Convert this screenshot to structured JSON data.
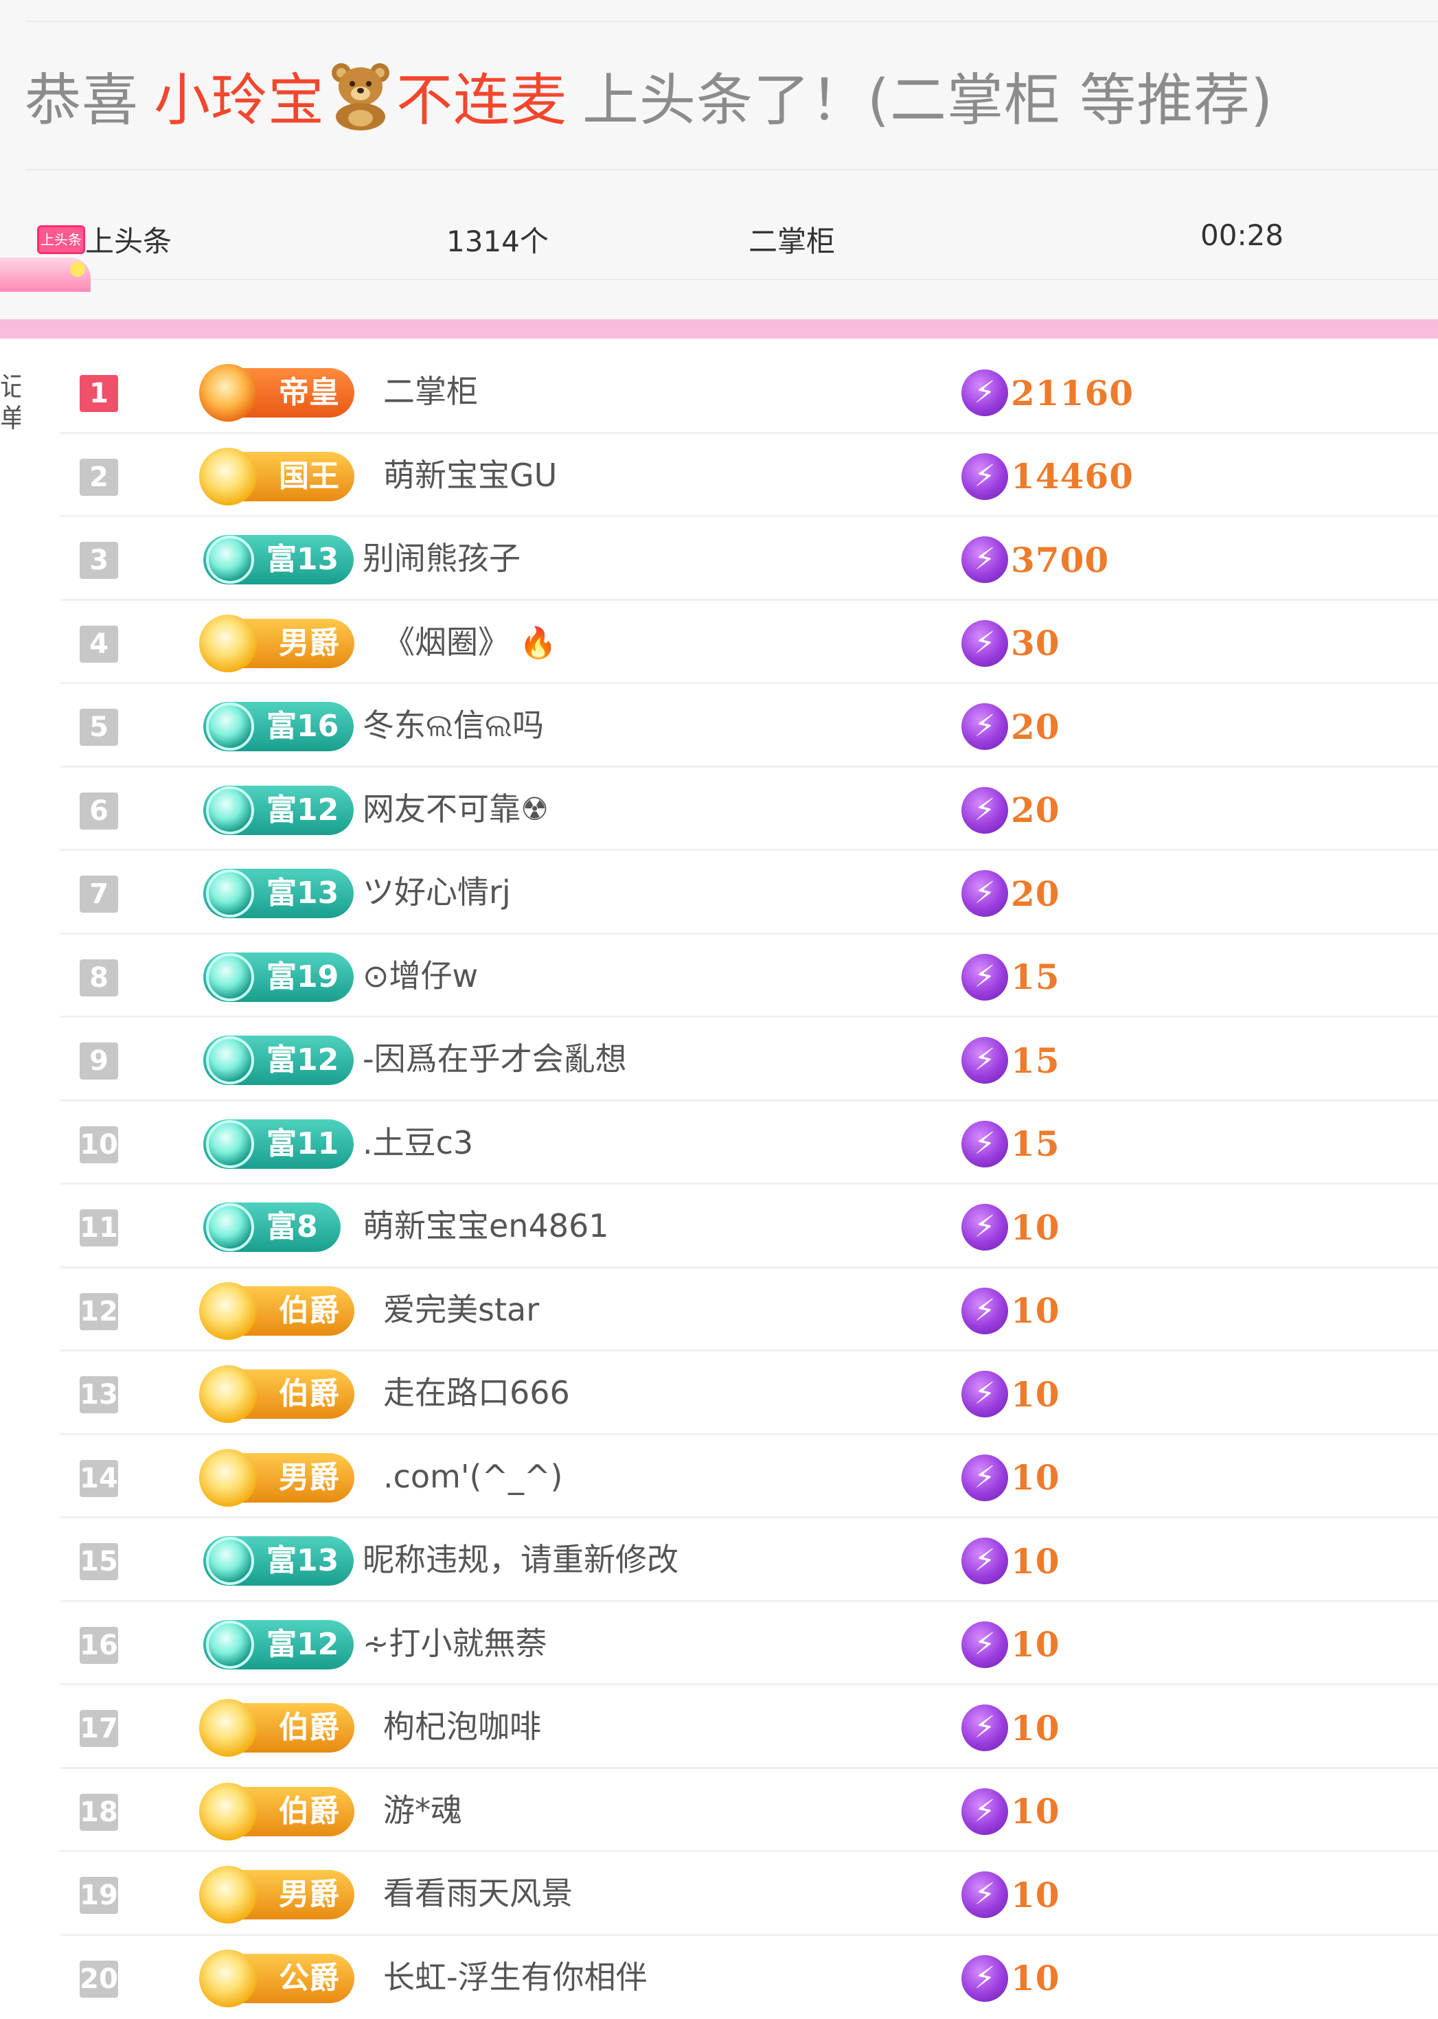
{
  "header": {
    "prefix": "恭喜",
    "nick_part1": "小玲宝",
    "bear_icon": "bear-emoji-icon",
    "nick_part2": "不连麦",
    "suffix": "上头条了！(二掌柜 等推荐)"
  },
  "info": {
    "tag_icon_label": "上头条",
    "label": "上头条",
    "count": "1314个",
    "sender": "二掌柜",
    "time": "00:28"
  },
  "side_text": "记单",
  "colors": {
    "accent_red": "#f2472d",
    "pink_bar": "#f8bcdc",
    "score_orange": "#ee7b2b",
    "teal_badge": "#1fae9c",
    "gold_badge": "#f0a11e"
  },
  "rows": [
    {
      "rank": "1",
      "badge": "帝皇",
      "style": "orange",
      "name": "二掌柜",
      "score": "21160"
    },
    {
      "rank": "2",
      "badge": "国王",
      "style": "gold",
      "name": "萌新宝宝GU",
      "score": "14460"
    },
    {
      "rank": "3",
      "badge": "富13",
      "style": "teal",
      "name": "别闹熊孩子",
      "score": "3700"
    },
    {
      "rank": "4",
      "badge": "男爵",
      "style": "gold",
      "name": "《烟圈》",
      "score": "30",
      "flame": true
    },
    {
      "rank": "5",
      "badge": "富16",
      "style": "teal",
      "name": "冬东ଲ信ଲ吗",
      "score": "20"
    },
    {
      "rank": "6",
      "badge": "富12",
      "style": "teal",
      "name": "网友不可靠☢",
      "score": "20"
    },
    {
      "rank": "7",
      "badge": "富13",
      "style": "teal",
      "name": "ツ好心情rj",
      "score": "20"
    },
    {
      "rank": "8",
      "badge": "富19",
      "style": "teal",
      "name": "⊙增仔w",
      "score": "15"
    },
    {
      "rank": "9",
      "badge": "富12",
      "style": "teal",
      "name": "-因爲在乎才会亂想",
      "score": "15"
    },
    {
      "rank": "10",
      "badge": "富11",
      "style": "teal",
      "name": ".土豆c3",
      "score": "15"
    },
    {
      "rank": "11",
      "badge": "富8",
      "style": "teal",
      "name": "萌新宝宝en4861",
      "score": "10"
    },
    {
      "rank": "12",
      "badge": "伯爵",
      "style": "gold",
      "name": "爱完美star",
      "score": "10"
    },
    {
      "rank": "13",
      "badge": "伯爵",
      "style": "gold",
      "name": "走在路口666",
      "score": "10"
    },
    {
      "rank": "14",
      "badge": "男爵",
      "style": "gold",
      "name": ".com'(^_^)",
      "score": "10"
    },
    {
      "rank": "15",
      "badge": "富13",
      "style": "teal",
      "name": "昵称违规，请重新修改",
      "score": "10"
    },
    {
      "rank": "16",
      "badge": "富12",
      "style": "teal",
      "name": "∻打小就無萘",
      "score": "10"
    },
    {
      "rank": "17",
      "badge": "伯爵",
      "style": "gold",
      "name": "枸杞泡咖啡",
      "score": "10"
    },
    {
      "rank": "18",
      "badge": "伯爵",
      "style": "gold",
      "name": "游*魂",
      "score": "10"
    },
    {
      "rank": "19",
      "badge": "男爵",
      "style": "gold",
      "name": "看看雨天风景",
      "score": "10"
    },
    {
      "rank": "20",
      "badge": "公爵",
      "style": "gold",
      "name": "长虹-浮生有你相伴",
      "score": "10"
    }
  ]
}
